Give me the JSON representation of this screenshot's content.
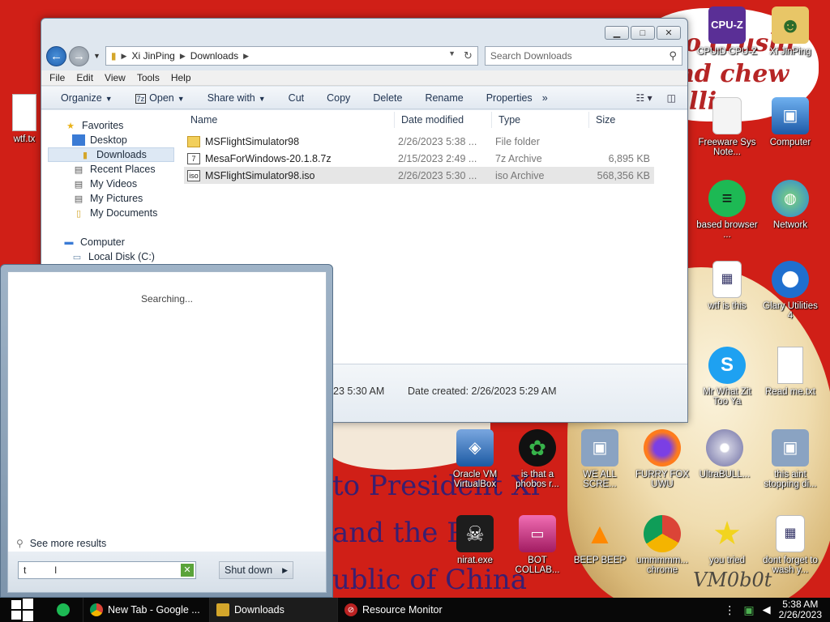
{
  "desktop": {
    "wallpaper_texts": [
      "to President Xi",
      "and the P",
      "ublic of China",
      "o crushi",
      "nd chew",
      "lli",
      "VM0b0t"
    ],
    "icons": [
      {
        "label": "CPUID CPU-Z",
        "icon": "cpu-z-icon",
        "color": "#6a3fa7"
      },
      {
        "label": "Xi JinPing",
        "icon": "user-folder-icon",
        "color": "#e2c36a"
      },
      {
        "label": "wtf.tx",
        "icon": "text-file-icon",
        "color": "#ffffff"
      },
      {
        "label": "Freeware Sys Note...",
        "icon": "notes-icon",
        "color": "#f5f5f5"
      },
      {
        "label": "Computer",
        "icon": "computer-icon",
        "color": "#3a7bd5"
      },
      {
        "label": "based browser ...",
        "icon": "browser-icon",
        "color": "#1db954"
      },
      {
        "label": "Network",
        "icon": "network-icon",
        "color": "#3a9ad9"
      },
      {
        "label": "wtf is this",
        "icon": "window-file-icon",
        "color": "#ffffff"
      },
      {
        "label": "Glary Utilities 4",
        "icon": "glary-icon",
        "color": "#1f6fcf"
      },
      {
        "label": "Mr What Zit Too Ya",
        "icon": "skype-icon",
        "color": "#1ea1f1"
      },
      {
        "label": "Read me.txt",
        "icon": "text-file-icon",
        "color": "#ffffff"
      },
      {
        "label": "Oracle VM VirtualBox",
        "icon": "virtualbox-icon",
        "color": "#1c5aa3"
      },
      {
        "label": "is that a phobos r...",
        "icon": "icq-icon",
        "color": "#37b34a"
      },
      {
        "label": "WE ALL SCRE...",
        "icon": "computer-icon",
        "color": "#6f8caf"
      },
      {
        "label": "FURRY FOX UWU",
        "icon": "firefox-icon",
        "color": "#ff7b1c"
      },
      {
        "label": "UltraBULL...",
        "icon": "disc-icon",
        "color": "#b9b9d6"
      },
      {
        "label": "this aint stopping di...",
        "icon": "computer-icon",
        "color": "#6f8caf"
      },
      {
        "label": "nirat.exe",
        "icon": "skull-icon",
        "color": "#2a2a2a"
      },
      {
        "label": "BOT COLLAB...",
        "icon": "monitor-icon",
        "color": "#d43c8a"
      },
      {
        "label": "BEEP BEEP",
        "icon": "vlc-icon",
        "color": "#ff8800"
      },
      {
        "label": "ummmmm... chrome",
        "icon": "chrome-icon",
        "color": "#2f9e44"
      },
      {
        "label": "you tried",
        "icon": "star-icon",
        "color": "#f2d41f"
      },
      {
        "label": "dont forget to wash y...",
        "icon": "window-file-icon",
        "color": "#ffffff"
      }
    ]
  },
  "explorer": {
    "breadcrumb": [
      "Xi JinPing",
      "Downloads"
    ],
    "search_placeholder": "Search Downloads",
    "menu": [
      "File",
      "Edit",
      "View",
      "Tools",
      "Help"
    ],
    "toolbar": [
      "Organize",
      "Open",
      "Share with",
      "Cut",
      "Copy",
      "Delete",
      "Rename",
      "Properties"
    ],
    "nav": {
      "favorites": "Favorites",
      "favorite_items": [
        "Desktop",
        "Downloads",
        "Recent Places",
        "My Videos",
        "My Pictures",
        "My Documents"
      ],
      "computer": "Computer",
      "drive": "Local Disk (C:)"
    },
    "columns": [
      "Name",
      "Date modified",
      "Type",
      "Size"
    ],
    "files": [
      {
        "name": "MSFlightSimulator98",
        "date": "2/26/2023 5:38 ...",
        "type": "File folder",
        "size": ""
      },
      {
        "name": "MesaForWindows-20.1.8.7z",
        "date": "2/15/2023 2:49 ...",
        "type": "7z Archive",
        "size": "6,895 KB"
      },
      {
        "name": "MSFlightSimulator98.iso",
        "date": "2/26/2023 5:30 ...",
        "type": "iso Archive",
        "size": "568,356 KB"
      }
    ],
    "details": {
      "modified_partial": "23 5:30 AM",
      "created_label": "Date created:",
      "created_value": "2/26/2023 5:29 AM"
    }
  },
  "startmenu": {
    "status": "Searching...",
    "see_more": "See more results",
    "search_value": "t",
    "shutdown": "Shut down"
  },
  "taskbar": {
    "tasks": [
      {
        "label": "New Tab - Google ...",
        "icon": "chrome-icon"
      },
      {
        "label": "Downloads",
        "icon": "folder-icon"
      },
      {
        "label": "Resource Monitor",
        "icon": "resource-monitor-icon"
      }
    ],
    "time": "5:38 AM",
    "date": "2/26/2023"
  }
}
